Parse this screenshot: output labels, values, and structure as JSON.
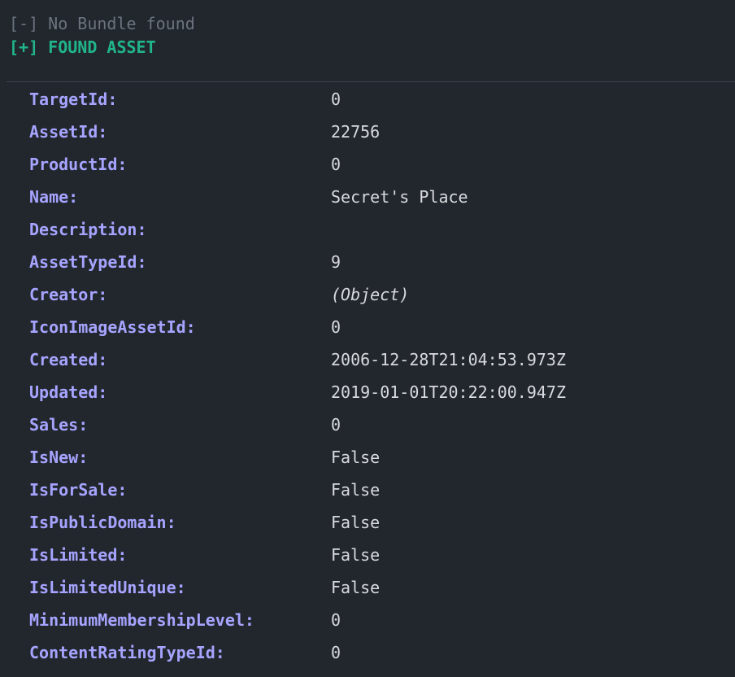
{
  "header": {
    "no_bundle": "[-] No Bundle found",
    "found_asset": "[+] FOUND ASSET"
  },
  "rows": [
    {
      "key": "TargetId:",
      "value": "0"
    },
    {
      "key": "AssetId:",
      "value": "22756"
    },
    {
      "key": "ProductId:",
      "value": "0"
    },
    {
      "key": "Name:",
      "value": "Secret's Place"
    },
    {
      "key": "Description:",
      "value": ""
    },
    {
      "key": "AssetTypeId:",
      "value": "9"
    },
    {
      "key": "Creator:",
      "value": "(Object)",
      "italic": true
    },
    {
      "key": "IconImageAssetId:",
      "value": "0"
    },
    {
      "key": "Created:",
      "value": "2006-12-28T21:04:53.973Z"
    },
    {
      "key": "Updated:",
      "value": "2019-01-01T20:22:00.947Z"
    },
    {
      "key": "Sales:",
      "value": "0"
    },
    {
      "key": "IsNew:",
      "value": "False"
    },
    {
      "key": "IsForSale:",
      "value": "False"
    },
    {
      "key": "IsPublicDomain:",
      "value": "False"
    },
    {
      "key": "IsLimited:",
      "value": "False"
    },
    {
      "key": "IsLimitedUnique:",
      "value": "False"
    },
    {
      "key": "MinimumMembershipLevel:",
      "value": "0"
    },
    {
      "key": "ContentRatingTypeId:",
      "value": "0"
    }
  ],
  "colors": {
    "background": "#22272e",
    "muted": "#6b737d",
    "success": "#20b58a",
    "key": "#a6a4ff",
    "value": "#d8dadd"
  }
}
